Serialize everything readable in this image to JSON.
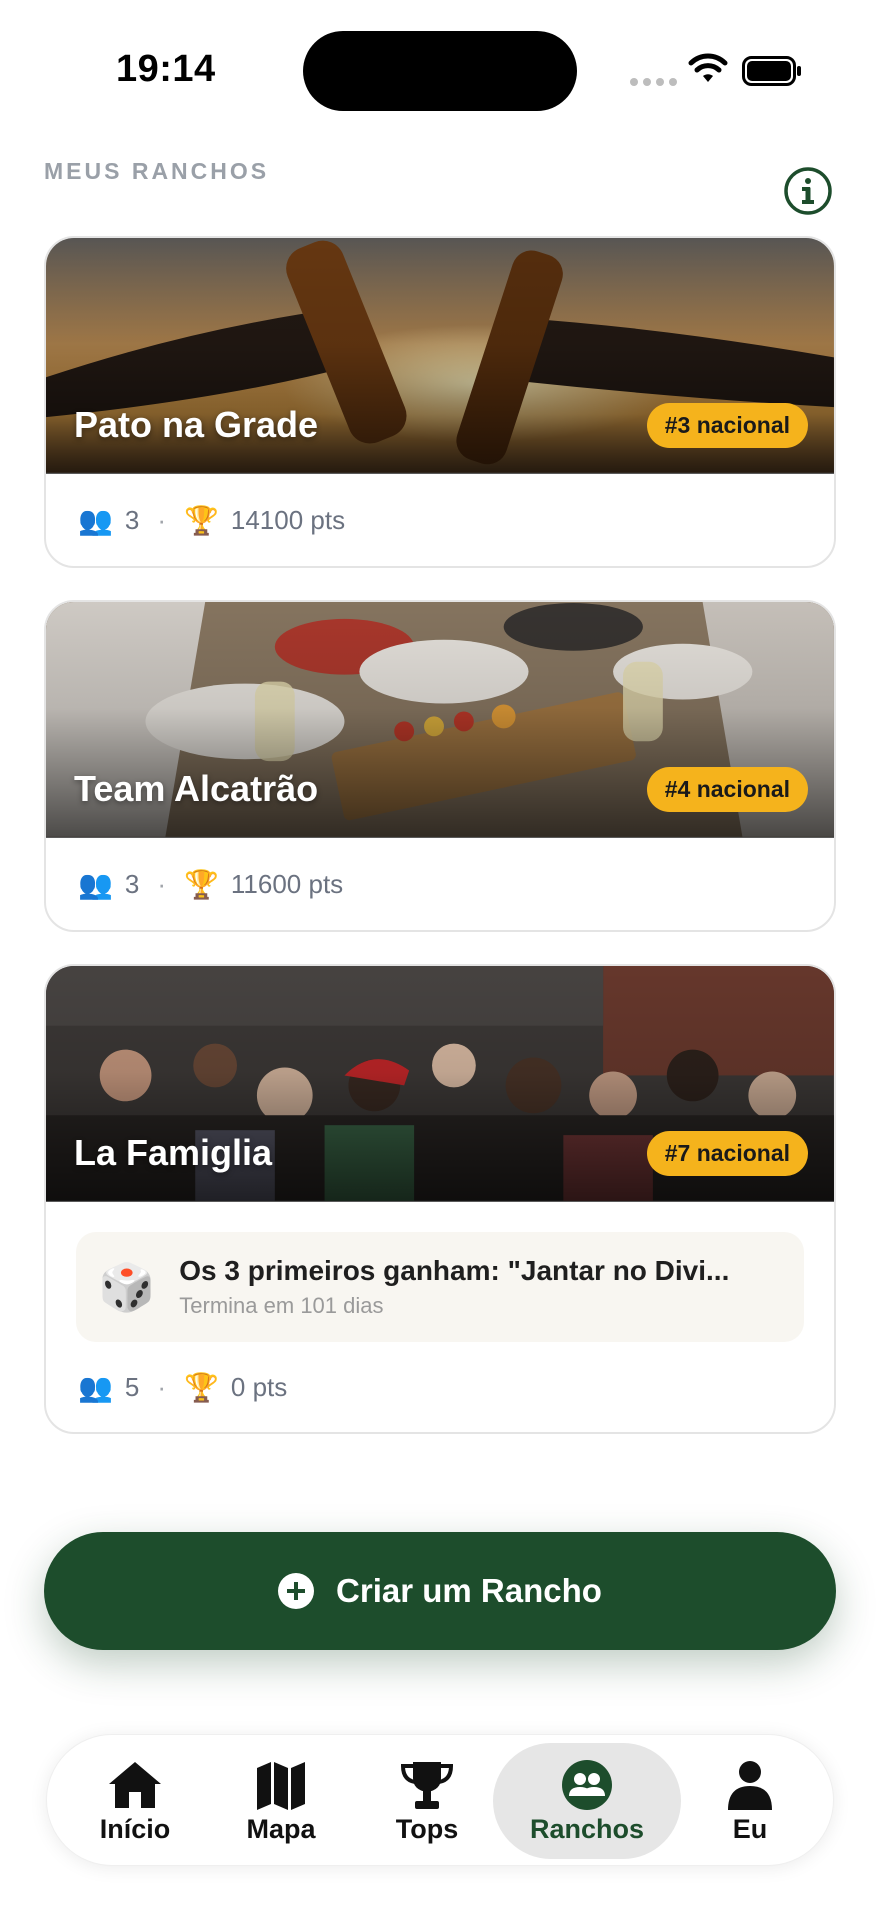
{
  "status_bar": {
    "time": "19:14"
  },
  "header": {
    "title": "MEUS RANCHOS"
  },
  "groups": [
    {
      "name": "Pato na Grade",
      "rank": "#3 nacional",
      "members": "3",
      "points": "14100 pts"
    },
    {
      "name": "Team Alcatrão",
      "rank": "#4 nacional",
      "members": "3",
      "points": "11600 pts"
    },
    {
      "name": "La Famiglia",
      "rank": "#7 nacional",
      "members": "5",
      "points": "0 pts",
      "challenge": {
        "title": "Os 3 primeiros ganham: \"Jantar no Divi...",
        "subtitle": "Termina em 101 dias"
      }
    }
  ],
  "separator": "·",
  "icons": {
    "members": "👥",
    "trophy": "🏆",
    "dice": "🎲"
  },
  "create_button": {
    "label": "Criar um Rancho"
  },
  "tabs": [
    {
      "label": "Início",
      "icon": "home-icon"
    },
    {
      "label": "Mapa",
      "icon": "map-icon"
    },
    {
      "label": "Tops",
      "icon": "trophy-icon"
    },
    {
      "label": "Ranchos",
      "icon": "group-icon",
      "active": true
    },
    {
      "label": "Eu",
      "icon": "person-icon"
    }
  ],
  "colors": {
    "brand_green": "#1d4d2c",
    "badge_yellow": "#f5b31c"
  }
}
